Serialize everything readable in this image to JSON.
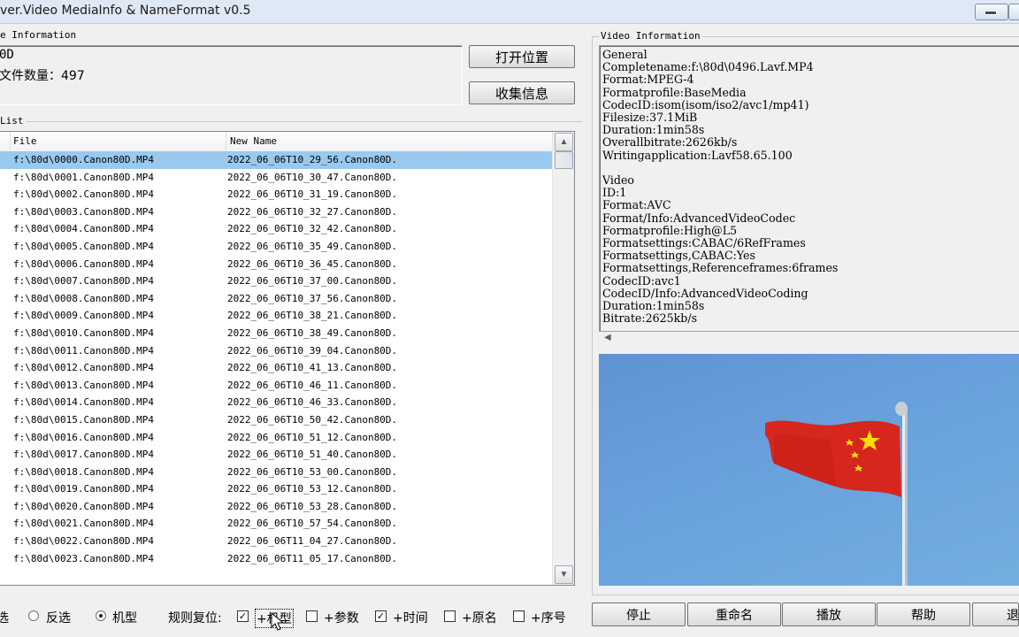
{
  "window": {
    "title": "ver.Video MediaInfo & NameFormat v0.5"
  },
  "file_info": {
    "group_label": "e Information",
    "line1": "0D",
    "line2": "文件数量：497",
    "open_location_button": "打开位置",
    "collect_info_button": "收集信息"
  },
  "file_list": {
    "group_label": "List",
    "headers": {
      "file": "File",
      "new_name": "New Name"
    },
    "rows": [
      {
        "file": "f:\\80d\\0000.Canon80D.MP4",
        "new_name": "2022_06_06T10_29_56.Canon80D."
      },
      {
        "file": "f:\\80d\\0001.Canon80D.MP4",
        "new_name": "2022_06_06T10_30_47.Canon80D."
      },
      {
        "file": "f:\\80d\\0002.Canon80D.MP4",
        "new_name": "2022_06_06T10_31_19.Canon80D."
      },
      {
        "file": "f:\\80d\\0003.Canon80D.MP4",
        "new_name": "2022_06_06T10_32_27.Canon80D."
      },
      {
        "file": "f:\\80d\\0004.Canon80D.MP4",
        "new_name": "2022_06_06T10_32_42.Canon80D."
      },
      {
        "file": "f:\\80d\\0005.Canon80D.MP4",
        "new_name": "2022_06_06T10_35_49.Canon80D."
      },
      {
        "file": "f:\\80d\\0006.Canon80D.MP4",
        "new_name": "2022_06_06T10_36_45.Canon80D."
      },
      {
        "file": "f:\\80d\\0007.Canon80D.MP4",
        "new_name": "2022_06_06T10_37_00.Canon80D."
      },
      {
        "file": "f:\\80d\\0008.Canon80D.MP4",
        "new_name": "2022_06_06T10_37_56.Canon80D."
      },
      {
        "file": "f:\\80d\\0009.Canon80D.MP4",
        "new_name": "2022_06_06T10_38_21.Canon80D."
      },
      {
        "file": "f:\\80d\\0010.Canon80D.MP4",
        "new_name": "2022_06_06T10_38_49.Canon80D."
      },
      {
        "file": "f:\\80d\\0011.Canon80D.MP4",
        "new_name": "2022_06_06T10_39_04.Canon80D."
      },
      {
        "file": "f:\\80d\\0012.Canon80D.MP4",
        "new_name": "2022_06_06T10_41_13.Canon80D."
      },
      {
        "file": "f:\\80d\\0013.Canon80D.MP4",
        "new_name": "2022_06_06T10_46_11.Canon80D."
      },
      {
        "file": "f:\\80d\\0014.Canon80D.MP4",
        "new_name": "2022_06_06T10_46_33.Canon80D."
      },
      {
        "file": "f:\\80d\\0015.Canon80D.MP4",
        "new_name": "2022_06_06T10_50_42.Canon80D."
      },
      {
        "file": "f:\\80d\\0016.Canon80D.MP4",
        "new_name": "2022_06_06T10_51_12.Canon80D."
      },
      {
        "file": "f:\\80d\\0017.Canon80D.MP4",
        "new_name": "2022_06_06T10_51_40.Canon80D."
      },
      {
        "file": "f:\\80d\\0018.Canon80D.MP4",
        "new_name": "2022_06_06T10_53_00.Canon80D."
      },
      {
        "file": "f:\\80d\\0019.Canon80D.MP4",
        "new_name": "2022_06_06T10_53_12.Canon80D."
      },
      {
        "file": "f:\\80d\\0020.Canon80D.MP4",
        "new_name": "2022_06_06T10_53_28.Canon80D."
      },
      {
        "file": "f:\\80d\\0021.Canon80D.MP4",
        "new_name": "2022_06_06T10_57_54.Canon80D."
      },
      {
        "file": "f:\\80d\\0022.Canon80D.MP4",
        "new_name": "2022_06_06T11_04_27.Canon80D."
      },
      {
        "file": "f:\\80d\\0023.Canon80D.MP4",
        "new_name": "2022_06_06T11_05_17.Canon80D."
      }
    ]
  },
  "video_info": {
    "group_label": "Video Information",
    "text": "General\nCompletename:f:\\80d\\0496.Lavf.MP4\nFormat:MPEG-4\nFormatprofile:BaseMedia\nCodecID:isom(isom/iso2/avc1/mp41)\nFilesize:37.1MiB\nDuration:1min58s\nOverallbitrate:2626kb/s\nWritingapplication:Lavf58.65.100\n\nVideo\nID:1\nFormat:AVC\nFormat/Info:AdvancedVideoCodec\nFormatprofile:High@L5\nFormatsettings:CABAC/6RefFrames\nFormatsettings,CABAC:Yes\nFormatsettings,Referenceframes:6frames\nCodecID:avc1\nCodecID/Info:AdvancedVideoCoding\nDuration:1min58s\nBitrate:2625kb/s"
  },
  "options": {
    "select_all_partial": "选",
    "invert": "反选",
    "model": "机型",
    "rule_reset": "规则复位:",
    "plus_model": "+机型",
    "plus_params": "+参数",
    "plus_time": "+时间",
    "plus_original": "+原名",
    "plus_seq": "+序号",
    "plus_model_checked": true,
    "plus_params_checked": false,
    "plus_time_checked": true,
    "plus_original_checked": false,
    "plus_seq_checked": false,
    "radio_selected": "model"
  },
  "buttons": {
    "stop": "停止",
    "rename": "重命名",
    "play": "播放",
    "help": "帮助",
    "exit_partial": "退"
  },
  "colors": {
    "selection": "#99c9ef",
    "sky": "#6aa2de",
    "flag": "#d7261e",
    "star": "#ffde00"
  }
}
